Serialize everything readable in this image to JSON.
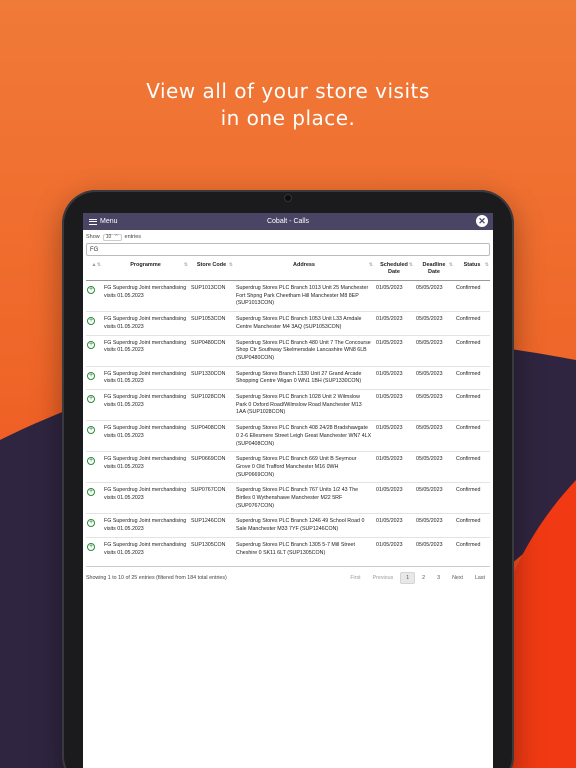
{
  "promo": {
    "line1": "View all of your store visits",
    "line2": "in one place."
  },
  "colors": {
    "background_orange": "#f06a2e",
    "background_red": "#f13a14",
    "wave_dark": "#2f2540",
    "titlebar": "#4a4564",
    "confirm_green": "#2d8a3b"
  },
  "app": {
    "menu_label": "Menu",
    "menu_icon": "hamburger-icon",
    "title": "Cobalt - Calls",
    "close_icon": "close-icon"
  },
  "controls": {
    "show_label": "Show",
    "entries_value": "10",
    "entries_label": "entries",
    "search_value": "FG"
  },
  "table": {
    "headers": {
      "programme": "Programme",
      "store_code": "Store Code",
      "address": "Address",
      "scheduled_date": "Scheduled Date",
      "deadline_date": "Deadline Date",
      "status": "Status"
    },
    "rows": [
      {
        "programme": "FG Superdrug Joint merchandising visits 01.05.2023",
        "code": "SUP1013CON",
        "address": "Superdrug Stores PLC Branch 1013 Unit 25 Manchester Fort Shpng Park Cheetham Hill Manchester M8 8EP (SUP1013CON)",
        "scheduled": "01/05/2023",
        "deadline": "05/05/2023",
        "status": "Confirmed"
      },
      {
        "programme": "FG Superdrug Joint merchandising visits 01.05.2023",
        "code": "SUP1053CON",
        "address": "Superdrug Stores PLC Branch 1053 Unit L33 Arndale Centre Manchester M4 3AQ (SUP1053CON)",
        "scheduled": "01/05/2023",
        "deadline": "05/05/2023",
        "status": "Confirmed"
      },
      {
        "programme": "FG Superdrug Joint merchandising visits 01.05.2023",
        "code": "SUP0480CON",
        "address": "Superdrug Stores PLC Branch 480 Unit 7 The Concourse Shop Ctr Southway Skelmersdale Lancashire WN8 6LB (SUP0480CON)",
        "scheduled": "01/05/2023",
        "deadline": "05/05/2023",
        "status": "Confirmed"
      },
      {
        "programme": "FG Superdrug Joint merchandising visits 01.05.2023",
        "code": "SUP1330CON",
        "address": "Superdrug Stores Branch 1330 Unit 27 Grand Arcade Shopping Centre Wigan 0 WN1 1BH (SUP1330CON)",
        "scheduled": "01/05/2023",
        "deadline": "05/05/2023",
        "status": "Confirmed"
      },
      {
        "programme": "FG Superdrug Joint merchandising visits 01.05.2023",
        "code": "SUP1028CON",
        "address": "Superdrug Stores PLC Branch 1028 Unit 2 Wilmslow Park 0 Oxford Road/Wilmslow Road Manchester M13 1AA (SUP1028CON)",
        "scheduled": "01/05/2023",
        "deadline": "05/05/2023",
        "status": "Confirmed"
      },
      {
        "programme": "FG Superdrug Joint merchandising visits 01.05.2023",
        "code": "SUP0408CON",
        "address": "Superdrug Stores PLC Branch 408 24/28 Bradshawgate 0 2-6 Ellesmere Street Leigh Great Manchester WN7 4LX (SUP0408CON)",
        "scheduled": "01/05/2023",
        "deadline": "05/05/2023",
        "status": "Confirmed"
      },
      {
        "programme": "FG Superdrug Joint merchandising visits 01.05.2023",
        "code": "SUP0669CON",
        "address": "Superdrug Stores PLC Branch 669 Unit B Seymour Grove 0 Old Trafford Manchester M16 0WH (SUP0669CON)",
        "scheduled": "01/05/2023",
        "deadline": "05/05/2023",
        "status": "Confirmed"
      },
      {
        "programme": "FG Superdrug Joint merchandising visits 01.05.2023",
        "code": "SUP0767CON",
        "address": "Superdrug Stores PLC Branch 767 Units 1/2 43 The Birtles 0 Wythenshawe Manchester M22 5RF (SUP0767CON)",
        "scheduled": "01/05/2023",
        "deadline": "05/05/2023",
        "status": "Confirmed"
      },
      {
        "programme": "FG Superdrug Joint merchandising visits 01.05.2023",
        "code": "SUP1246CON",
        "address": "Superdrug Stores PLC Branch 1246 49 School Road 0 Sale Manchester M33 7YF (SUP1246CON)",
        "scheduled": "01/05/2023",
        "deadline": "05/05/2023",
        "status": "Confirmed"
      },
      {
        "programme": "FG Superdrug Joint merchandising visits 01.05.2023",
        "code": "SUP1305CON",
        "address": "Superdrug Stores PLC Branch 1305 5-7 Mill Street Cheshire 0 SK11 6LT (SUP1305CON)",
        "scheduled": "01/05/2023",
        "deadline": "05/05/2023",
        "status": "Confirmed"
      }
    ]
  },
  "footer": {
    "info": "Showing 1 to 10 of 25 entries (filtered from 184 total entries)",
    "pagination": {
      "first": "First",
      "previous": "Previous",
      "page1": "1",
      "page2": "2",
      "page3": "3",
      "next": "Next",
      "last": "Last"
    }
  }
}
